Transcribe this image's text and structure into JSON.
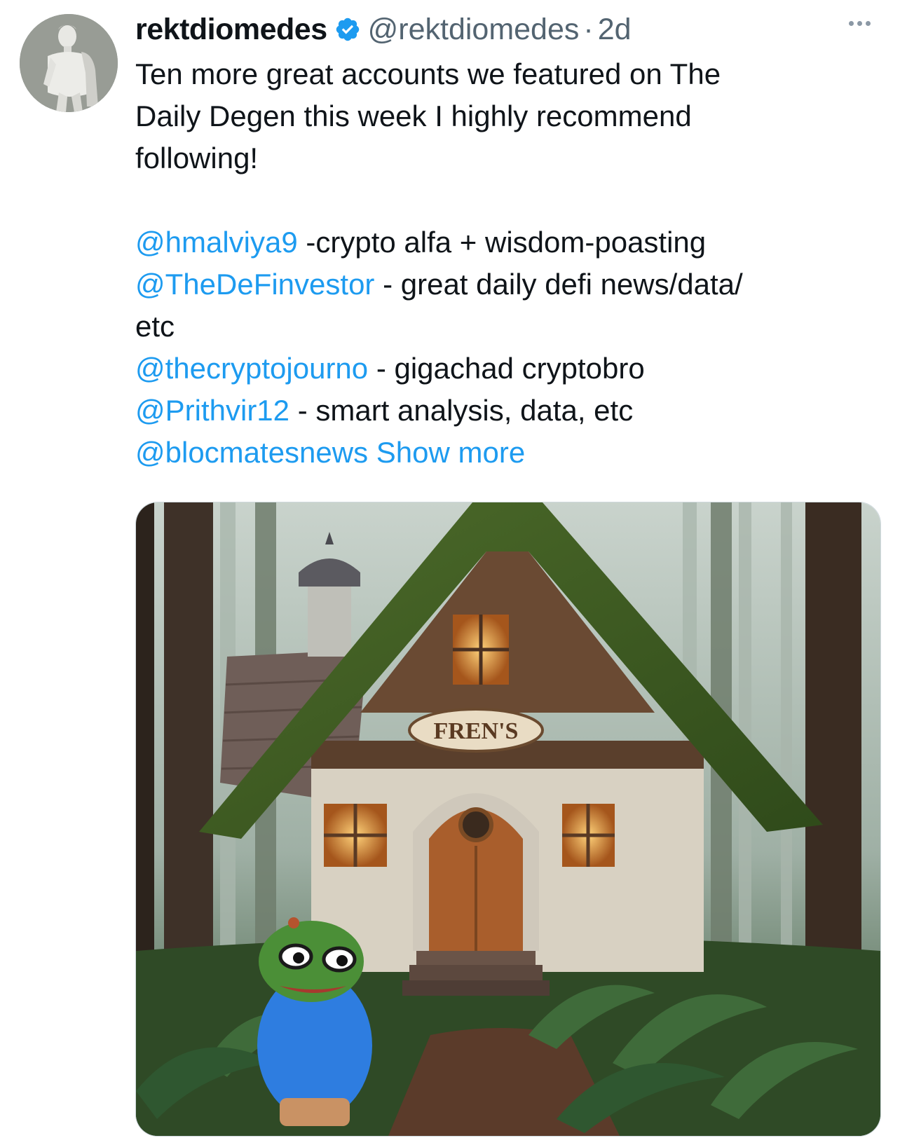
{
  "tweet": {
    "author_name": "rektdiomedes",
    "handle": "@rektdiomedes",
    "separator": "·",
    "time": "2d",
    "intro_line1": "Ten more great accounts we featured on The",
    "intro_line2": "Daily Degen this week I highly recommend",
    "intro_line3": "following!",
    "accounts": [
      {
        "mention": "@hmalviya9",
        "desc": " -crypto alfa + wisdom-poasting"
      },
      {
        "mention": "@TheDeFinvestor",
        "desc": " - great daily defi news/data/",
        "desc_cont": "etc"
      },
      {
        "mention": "@thecryptojourno",
        "desc": " - gigachad cryptobro"
      },
      {
        "mention": "@Prithvir12",
        "desc": " - smart analysis, data, etc"
      }
    ],
    "last_mention": "@blocmatesnews",
    "show_more": "Show more"
  },
  "media": {
    "sign_text": "FREN'S"
  },
  "icons": {
    "verified": "verified-badge-icon",
    "more": "more-options-icon"
  },
  "colors": {
    "link": "#1d9bf0",
    "muted": "#536471",
    "text": "#0f1419"
  }
}
